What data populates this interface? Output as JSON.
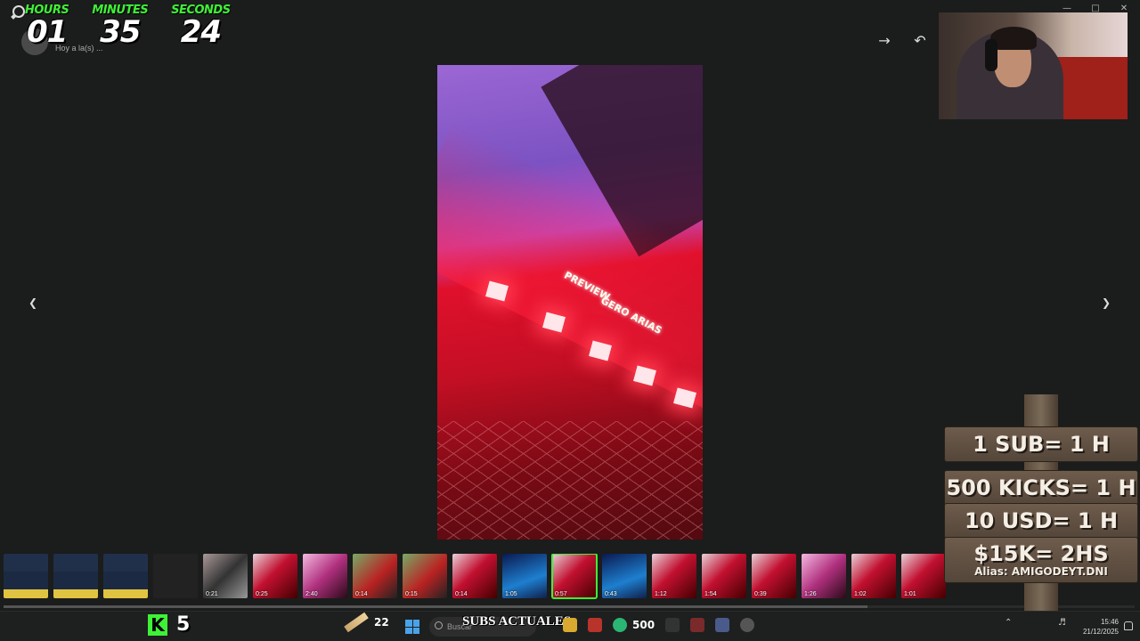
{
  "timer": {
    "hours_label": "HOURS",
    "minutes_label": "MINUTES",
    "seconds_label": "SECONDS",
    "hours": "01",
    "minutes": "35",
    "seconds": "24"
  },
  "viewer": {
    "sender_subtitle": "Hoy a la(s) ...",
    "forward_icon": "arrow-right-icon",
    "reply_icon": "reply-icon",
    "prev_icon": "chevron-left-icon",
    "next_icon": "chevron-right-icon",
    "media_overlay_text_1": "PREVIEW",
    "media_overlay_text_2": "GERO ARIAS"
  },
  "thumbnails": [
    {
      "kind": "doc",
      "duration": ""
    },
    {
      "kind": "doc",
      "duration": ""
    },
    {
      "kind": "doc",
      "duration": ""
    },
    {
      "kind": "dark",
      "duration": ""
    },
    {
      "kind": "crowd",
      "duration": "0:21"
    },
    {
      "kind": "red",
      "duration": "0:25"
    },
    {
      "kind": "pink",
      "duration": "2:40"
    },
    {
      "kind": "green",
      "duration": "0:14"
    },
    {
      "kind": "green",
      "duration": "0:15"
    },
    {
      "kind": "red",
      "duration": "0:14"
    },
    {
      "kind": "blue",
      "duration": "1:05"
    },
    {
      "kind": "red",
      "duration": "0:57",
      "selected": true
    },
    {
      "kind": "blue",
      "duration": "0:43"
    },
    {
      "kind": "red",
      "duration": "1:12"
    },
    {
      "kind": "red",
      "duration": "1:54"
    },
    {
      "kind": "red",
      "duration": "0:39"
    },
    {
      "kind": "pink",
      "duration": "1:26"
    },
    {
      "kind": "red",
      "duration": "1:02"
    },
    {
      "kind": "red",
      "duration": "1:01"
    }
  ],
  "sign": {
    "line1": "1 SUB= 1 H",
    "line2": "500 KICKS= 1 H",
    "line3": "10 USD= 1 H",
    "line4": "$15K= 2HS",
    "alias": "Alias: AMIGODEYT.DNI"
  },
  "overlay": {
    "kick_count": "5",
    "bits_count": "22",
    "subs_label": "SUBS ACTUALES",
    "subs_goal": "500"
  },
  "taskbar": {
    "search_placeholder": "Buscar",
    "time": "15:46",
    "date": "21/12/2025"
  },
  "colors": {
    "accent_green": "#3ef236",
    "background": "#1b1c1c"
  }
}
